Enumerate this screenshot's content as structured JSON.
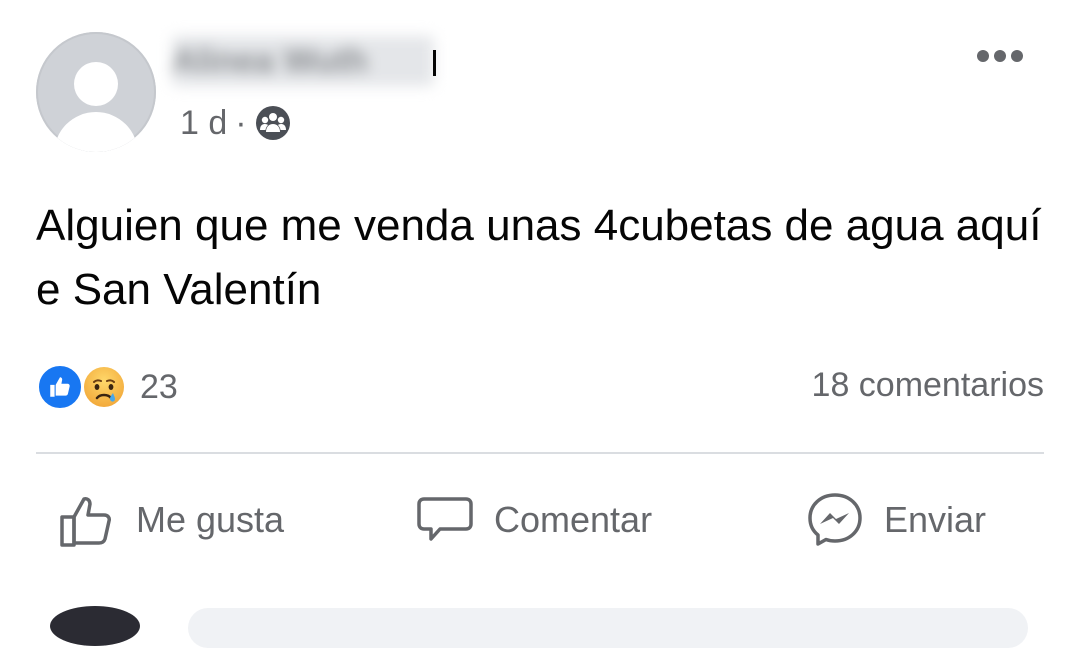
{
  "post": {
    "author_name": "Alinea Wuth",
    "time": "1 d",
    "separator": "·",
    "audience_icon": "group-icon",
    "more_icon": "more-dots-icon",
    "text": "Alguien que me venda unas 4cubetas de agua aquí e San Valentín"
  },
  "stats": {
    "reaction_icons": [
      "like-reaction-icon",
      "sad-reaction-icon"
    ],
    "reaction_count": "23",
    "comments": "18 comentarios"
  },
  "actions": {
    "like_label": "Me gusta",
    "comment_label": "Comentar",
    "send_label": "Enviar"
  },
  "colors": {
    "like_blue": "#1877f2",
    "secondary_text": "#65676b",
    "divider": "#dadde1"
  }
}
